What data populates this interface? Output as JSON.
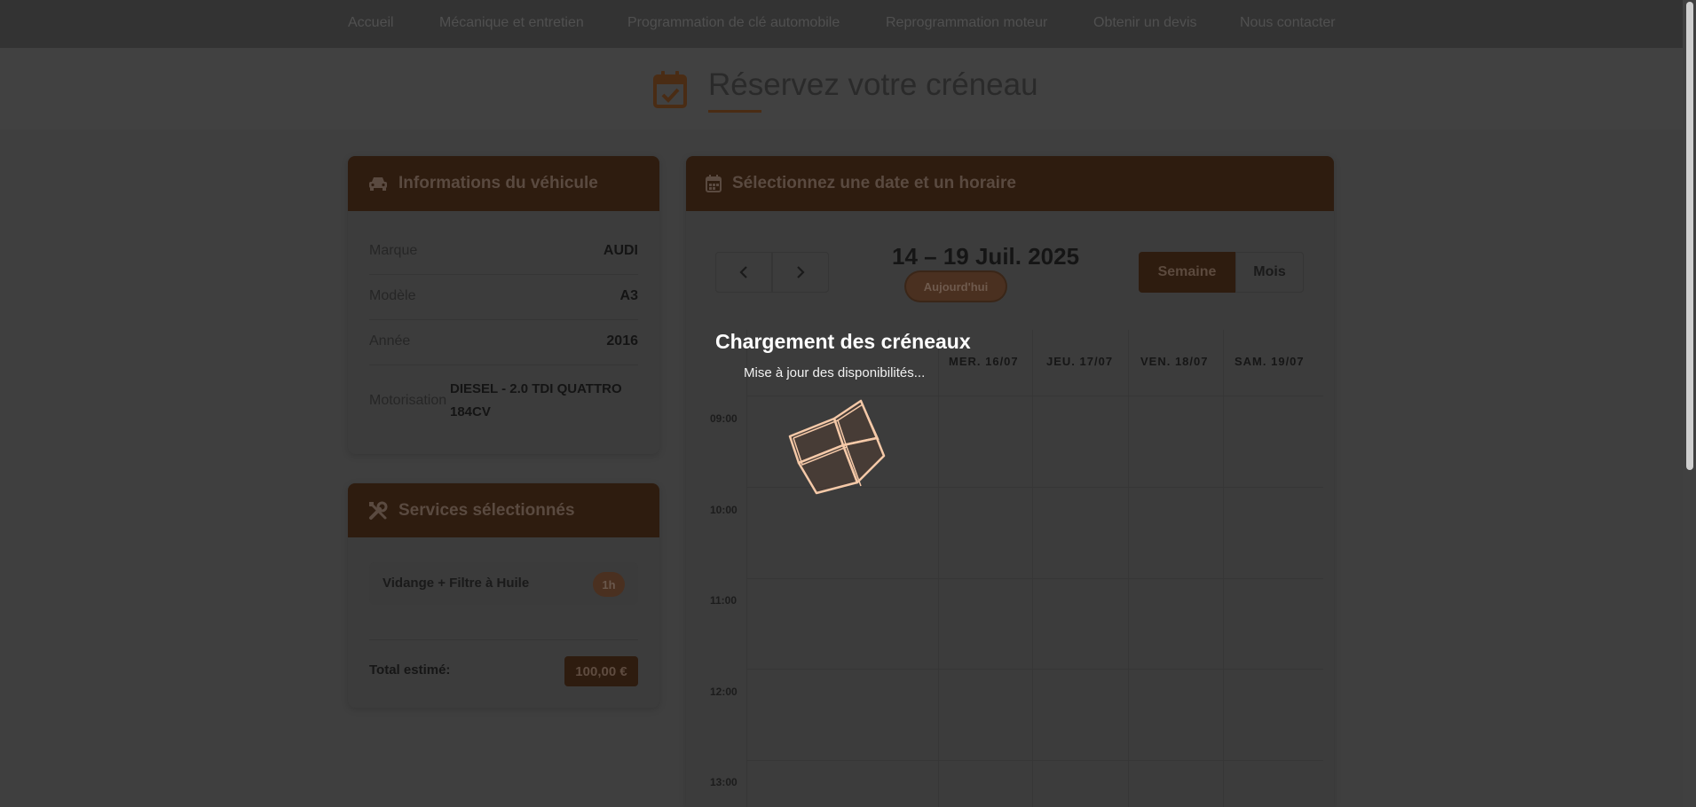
{
  "nav": {
    "items": [
      "Accueil",
      "Mécanique et entretien",
      "Programmation de clé automobile",
      "Reprogrammation moteur",
      "Obtenir un devis",
      "Nous contacter"
    ]
  },
  "page": {
    "title": "Réservez votre créneau"
  },
  "vehicle": {
    "header": "Informations du véhicule",
    "rows": [
      {
        "label": "Marque",
        "value": "AUDI"
      },
      {
        "label": "Modèle",
        "value": "A3"
      },
      {
        "label": "Année",
        "value": "2016"
      },
      {
        "label": "Motorisation",
        "value": "DIESEL - 2.0 TDI QUATTRO 184CV"
      }
    ]
  },
  "services": {
    "header": "Services sélectionnés",
    "items": [
      {
        "name": "Vidange + Filtre à Huile",
        "duration": "1h"
      }
    ],
    "total_label": "Total estimé:",
    "total_value": "100,00 €"
  },
  "calendar": {
    "header": "Sélectionnez une date et un horaire",
    "range": "14 – 19 Juil. 2025",
    "today_label": "Aujourd'hui",
    "views": {
      "week": "Semaine",
      "month": "Mois",
      "active": "week"
    },
    "visible_days": [
      "MER. 16/07",
      "JEU. 17/07",
      "VEN. 18/07",
      "SAM. 19/07"
    ],
    "times": [
      "09:00",
      "10:00",
      "11:00",
      "12:00",
      "13:00"
    ]
  },
  "loader": {
    "title": "Chargement des créneaux",
    "subtitle": "Mise à jour des disponibilités..."
  },
  "colors": {
    "brand": "#2e1c0f",
    "accent_active": "#4a2a12",
    "loader_stroke": "#f5c9a8"
  }
}
